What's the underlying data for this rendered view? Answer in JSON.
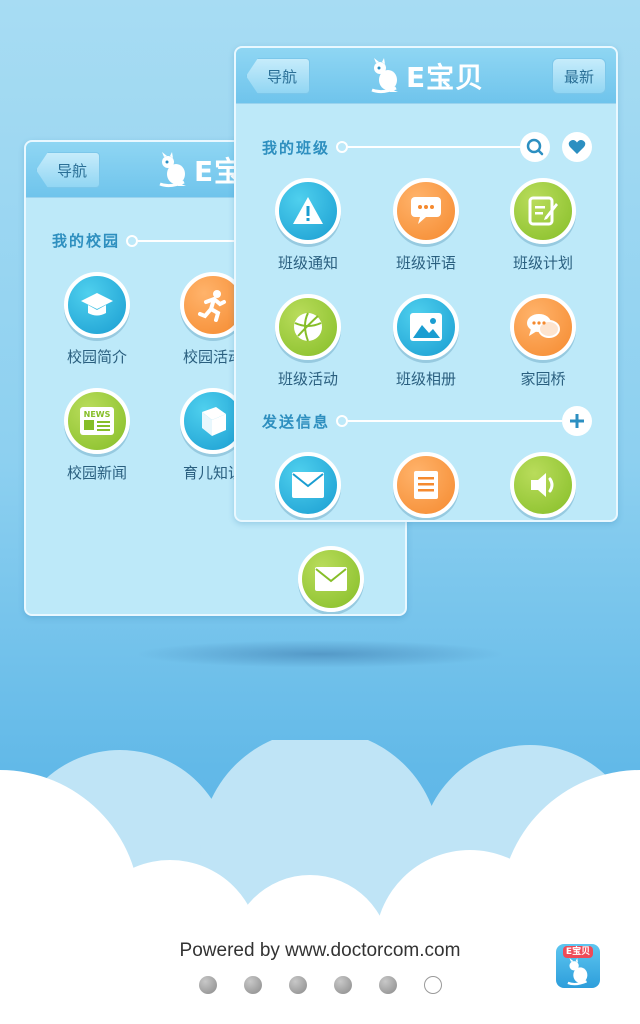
{
  "back_panel": {
    "nav_label": "导航",
    "brand": "E宝",
    "section_title": "我的校园",
    "items": [
      {
        "label": "校园简介",
        "icon": "graduation-cap-icon",
        "color": "#1a9dd1"
      },
      {
        "label": "校园活动",
        "icon": "running-icon",
        "color": "#f58a2f"
      },
      {
        "label": "校园新闻",
        "icon": "news-icon",
        "color": "#86be28"
      },
      {
        "label": "育儿知识",
        "icon": "book-icon",
        "color": "#1a9dd1"
      }
    ],
    "extra_icon": "mail-icon"
  },
  "front_panel": {
    "nav_label": "导航",
    "brand": "E宝贝",
    "right_label": "最新",
    "class_section_title": "我的班级",
    "class_items": [
      {
        "label": "班级通知",
        "icon": "warning-icon",
        "color": "#1a9dd1"
      },
      {
        "label": "班级评语",
        "icon": "chat-bubble-icon",
        "color": "#f58a2f"
      },
      {
        "label": "班级计划",
        "icon": "edit-icon",
        "color": "#86be28"
      },
      {
        "label": "班级活动",
        "icon": "ball-icon",
        "color": "#86be28"
      },
      {
        "label": "班级相册",
        "icon": "picture-icon",
        "color": "#1a9dd1"
      },
      {
        "label": "家园桥",
        "icon": "chat-icon",
        "color": "#f58a2f"
      }
    ],
    "send_section_title": "发送信息",
    "send_items": [
      {
        "icon": "mail-icon",
        "color": "#1a9dd1"
      },
      {
        "icon": "note-icon",
        "color": "#f58a2f"
      },
      {
        "icon": "speaker-icon",
        "color": "#86be28"
      }
    ]
  },
  "footer": {
    "powered_by": "Powered by www.doctorcom.com",
    "app_badge": "E宝贝",
    "page_count": 6,
    "active_page": 6
  }
}
